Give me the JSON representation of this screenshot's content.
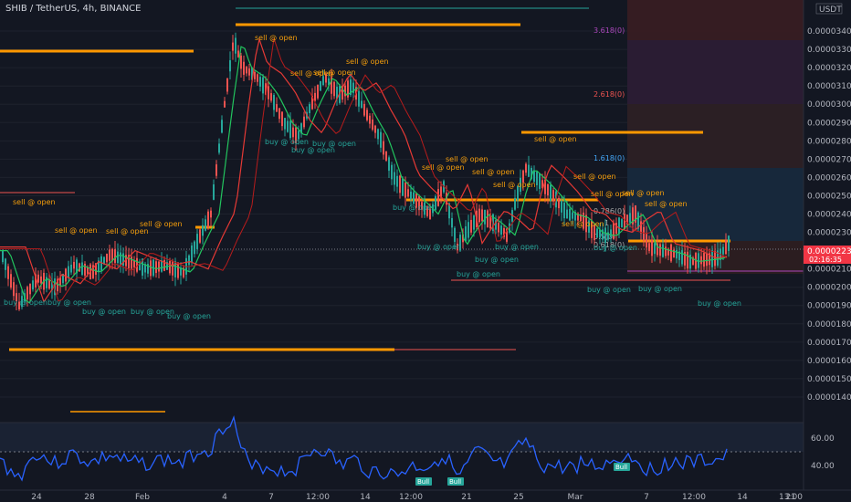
{
  "header": {
    "symbol_title": "SHIB / TetherUS, 4h, BINANCE"
  },
  "chart_data": {
    "type": "candlestick",
    "price_axis": {
      "unit_label": "USDT",
      "ticks": [
        "0.00003400",
        "0.00003300",
        "0.00003200",
        "0.00003100",
        "0.00003000",
        "0.00002900",
        "0.00002800",
        "0.00002700",
        "0.00002600",
        "0.00002500",
        "0.00002400",
        "0.00002300",
        "0.00002200",
        "0.00002100",
        "0.00002000",
        "0.00001900",
        "0.00001800",
        "0.00001700",
        "0.00001600",
        "0.00001500",
        "0.00001400"
      ],
      "last_price": "0.00002235",
      "countdown": "02:16:35",
      "ylim": [
        1.34e-05,
        3.52e-05
      ]
    },
    "time_axis": {
      "ticks": [
        "24",
        "28",
        "Feb",
        "4",
        "7",
        "12:00",
        "14",
        "12:00",
        "21",
        "25",
        "Mar",
        "7",
        "12:00",
        "14",
        "13:00",
        "21"
      ]
    },
    "fib_levels": [
      "3.618(0)",
      "2.618(0)",
      "1.618(0)",
      "1",
      "0.786(0)",
      "0.618(0)",
      "0.5(0)"
    ],
    "signals": {
      "sell": [
        "sell @ open",
        "sell @ open",
        "sell @ open",
        "sell @ open",
        "sell @ open",
        "sell @ open",
        "sell @ open",
        "sell @ open",
        "sell @ open",
        "sell @ open",
        "sell @ open",
        "sell @ open",
        "sell @ open",
        "sell @ open",
        "sell @ open",
        "sell @ open",
        "sell @ open",
        "sell @ open"
      ],
      "buy": [
        "buy @ open",
        "buy @ open",
        "buy @ open",
        "buy @ open",
        "buy @ open",
        "buy @ open",
        "buy @ open",
        "buy @ open",
        "buy @ open",
        "buy @ open",
        "buy @ open",
        "buy @ open",
        "buy @ open",
        "buy @ open",
        "buy @ open",
        "buy @ open",
        "buy @ open"
      ]
    },
    "oscillator": {
      "ticks": [
        "60.00",
        "40.00"
      ],
      "markers": [
        "Bull",
        "Bull",
        "Bull"
      ]
    }
  },
  "colors": {
    "background": "#131722",
    "bull": "#26a69a",
    "bear": "#ef5350",
    "level_line": "#ff9800",
    "oscillator_line": "#2962ff",
    "fast_ma": "#22c55e",
    "slow_ma": "#e53935"
  }
}
